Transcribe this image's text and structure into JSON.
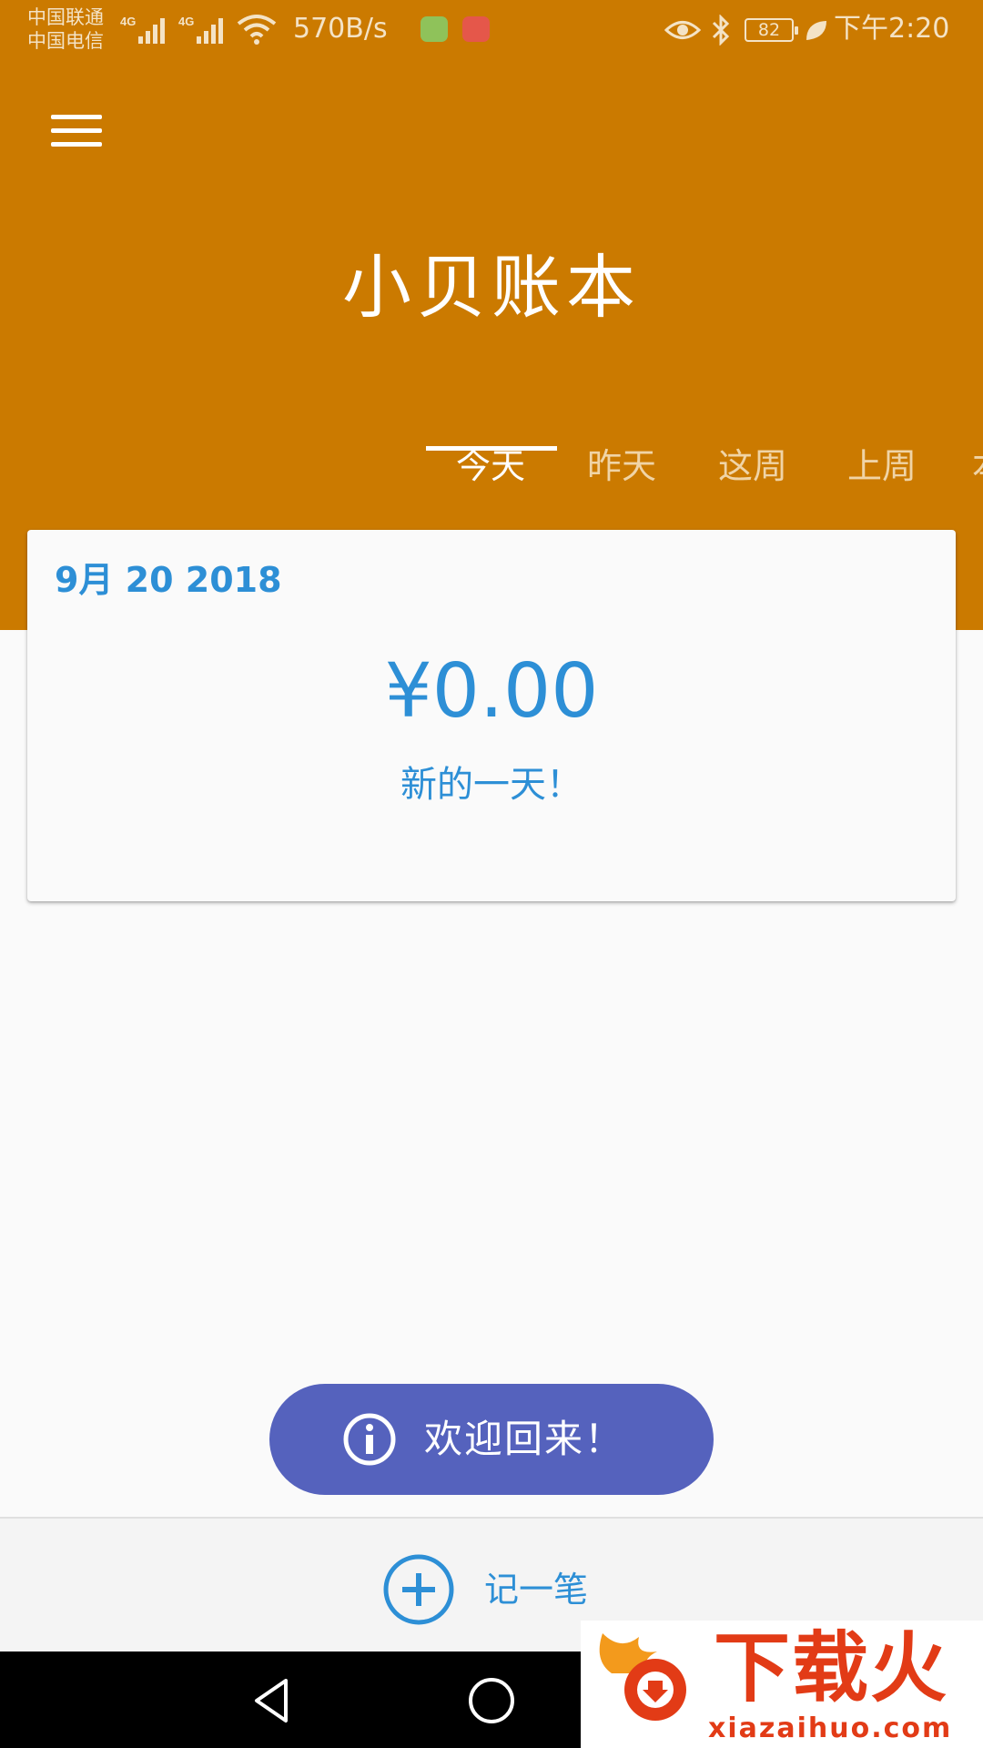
{
  "status_bar": {
    "carrier_1": "中国联通",
    "carrier_2": "中国电信",
    "network_1": "4G",
    "network_2": "4G",
    "speed": "570B/s",
    "battery": "82",
    "time": "下午2:20",
    "icons": [
      "signal-icon",
      "wifi-icon",
      "eye-icon",
      "bluetooth-icon",
      "leaf-icon"
    ]
  },
  "app_bar": {
    "title": "小贝账本",
    "menu_icon": "hamburger-menu-icon"
  },
  "tabs": [
    {
      "label": "今天",
      "active": true
    },
    {
      "label": "昨天",
      "active": false
    },
    {
      "label": "这周",
      "active": false
    },
    {
      "label": "上周",
      "active": false
    }
  ],
  "card": {
    "date": "9月 20 2018",
    "amount": "¥0.00",
    "note": "新的一天！"
  },
  "snackbar": {
    "icon": "info-icon",
    "text": "欢迎回来！"
  },
  "bottom_bar": {
    "add_icon": "plus-circle-icon",
    "add_label": "记一笔"
  },
  "nav_bar": {
    "icons": [
      "back-icon",
      "home-icon"
    ]
  },
  "watermark": {
    "text": "下载火",
    "url": "xiazaihuo.com"
  },
  "colors": {
    "primary": "#cb7a00",
    "accent_blue": "#2d8fd6",
    "snackbar": "#5562bd",
    "background": "#fafafa"
  }
}
